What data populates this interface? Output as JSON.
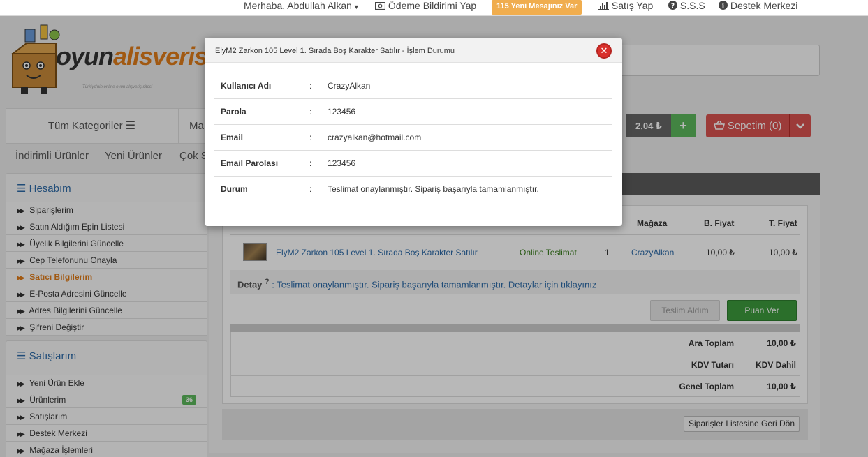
{
  "topbar": {
    "greeting": "Merhaba, Abdullah Alkan",
    "payment_notice": "Ödeme Bildirimi Yap",
    "messages": "115 Yeni Mesajınız Var",
    "sell": "Satış Yap",
    "faq": "S.S.S",
    "support": "Destek Merkezi"
  },
  "logo": {
    "part1": "oyun",
    "part2": "alisveris",
    "tagline": "Türkiye'nin online oyun alışveriş sitesi"
  },
  "nav": {
    "all_categories": "Tüm Kategoriler",
    "store": "Ma",
    "discounted": "İndirimli Ürünler",
    "new": "Yeni Ürünler",
    "most_sold": "Çok S"
  },
  "header_right": {
    "balance": "2,04 ₺",
    "cart": "Sepetim (0)"
  },
  "account_panel": {
    "title": "Hesabım",
    "items": [
      "Siparişlerim",
      "Satın Aldığım Epin Listesi",
      "Üyelik Bilgilerini Güncelle",
      "Cep Telefonunu Onayla",
      "Satıcı Bilgilerim",
      "E-Posta Adresini Güncelle",
      "Adres Bilgilerini Güncelle",
      "Şifreni Değiştir"
    ]
  },
  "sales_panel": {
    "title": "Satışlarım",
    "items": [
      "Yeni Ürün Ekle",
      "Ürünlerim",
      "Satışlarım",
      "Destek Merkezi",
      "Mağaza İşlemleri"
    ],
    "products_badge": "36"
  },
  "order": {
    "headers": {
      "store": "Mağaza",
      "unit_price": "B. Fiyat",
      "total_price": "T. Fiyat"
    },
    "row": {
      "product": "ElyM2 Zarkon 105 Level 1. Sırada Boş Karakter Satılır",
      "delivery": "Online Teslimat",
      "qty": "1",
      "store": "CrazyAlkan",
      "unit_price": "10,00 ₺",
      "total_price": "10,00 ₺"
    },
    "detail_label": "Detay",
    "detail_sup": "?",
    "detail_text": ": Teslimat onaylanmıştır. Sipariş başarıyla tamamlanmıştır. Detaylar için tıklayınız",
    "btn_received": "Teslim Aldım",
    "btn_rate": "Puan Ver",
    "summary": [
      {
        "label": "Ara Toplam",
        "value": "10,00 ₺"
      },
      {
        "label": "KDV Tutarı",
        "value": "KDV Dahil"
      },
      {
        "label": "Genel Toplam",
        "value": "10,00 ₺"
      }
    ],
    "btn_back": "Siparişler Listesine Geri Dön"
  },
  "modal": {
    "title": "ElyM2 Zarkon 105 Level 1. Sırada Boş Karakter Satılır - İşlem Durumu",
    "rows": [
      {
        "label": "Kullanıcı Adı",
        "value": "CrazyAlkan"
      },
      {
        "label": "Parola",
        "value": "123456"
      },
      {
        "label": "Email",
        "value": "crazyalkan@hotmail.com"
      },
      {
        "label": "Email Parolası",
        "value": "123456"
      },
      {
        "label": "Durum",
        "value": "Teslimat onaylanmıştır. Sipariş başarıyla tamamlanmıştır."
      }
    ],
    "separator": ":"
  },
  "colors": {
    "accent_blue": "#2d6aa7",
    "orange": "#e07c1a",
    "green": "#5cb85c",
    "red": "#d9534f"
  }
}
